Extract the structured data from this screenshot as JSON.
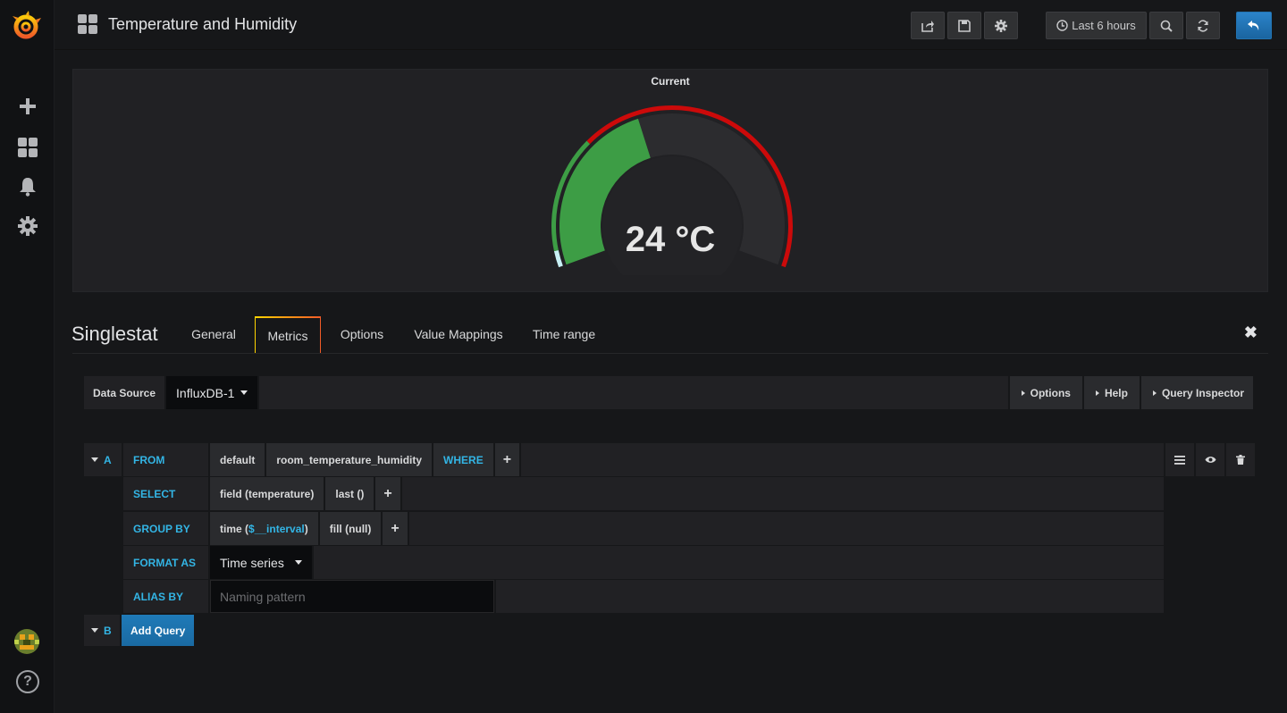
{
  "header": {
    "dashboard_title": "Temperature and Humidity",
    "time_range_label": "Last 6 hours"
  },
  "panel": {
    "title": "Current",
    "value": "24 °C",
    "gauge_fraction": 0.42
  },
  "editor": {
    "panel_type": "Singlestat",
    "tabs": [
      {
        "label": "General",
        "active": false
      },
      {
        "label": "Metrics",
        "active": true
      },
      {
        "label": "Options",
        "active": false
      },
      {
        "label": "Value Mappings",
        "active": false
      },
      {
        "label": "Time range",
        "active": false
      }
    ],
    "datasource": {
      "label": "Data Source",
      "value": "InfluxDB-1",
      "options_btn": "Options",
      "help_btn": "Help",
      "inspector_btn": "Query Inspector"
    },
    "query_a": {
      "ref": "A",
      "from_label": "FROM",
      "policy": "default",
      "measurement": "room_temperature_humidity",
      "where_label": "WHERE",
      "select_label": "SELECT",
      "select_field": "field (temperature)",
      "select_fn": "last ()",
      "groupby_label": "GROUP BY",
      "groupby_time_prefix": "time (",
      "groupby_time_var": "$__interval",
      "groupby_time_suffix": ")",
      "groupby_fill": "fill (null)",
      "format_label": "FORMAT AS",
      "format_value": "Time series",
      "alias_label": "ALIAS BY",
      "alias_placeholder": "Naming pattern"
    },
    "query_b": {
      "ref": "B",
      "add_query": "Add Query"
    },
    "plus": "+",
    "close": "✖"
  },
  "colors": {
    "green": "#3d9d45",
    "red": "#cc0a0a",
    "ice": "#c8f0f5",
    "accent": "#33b5e5"
  }
}
